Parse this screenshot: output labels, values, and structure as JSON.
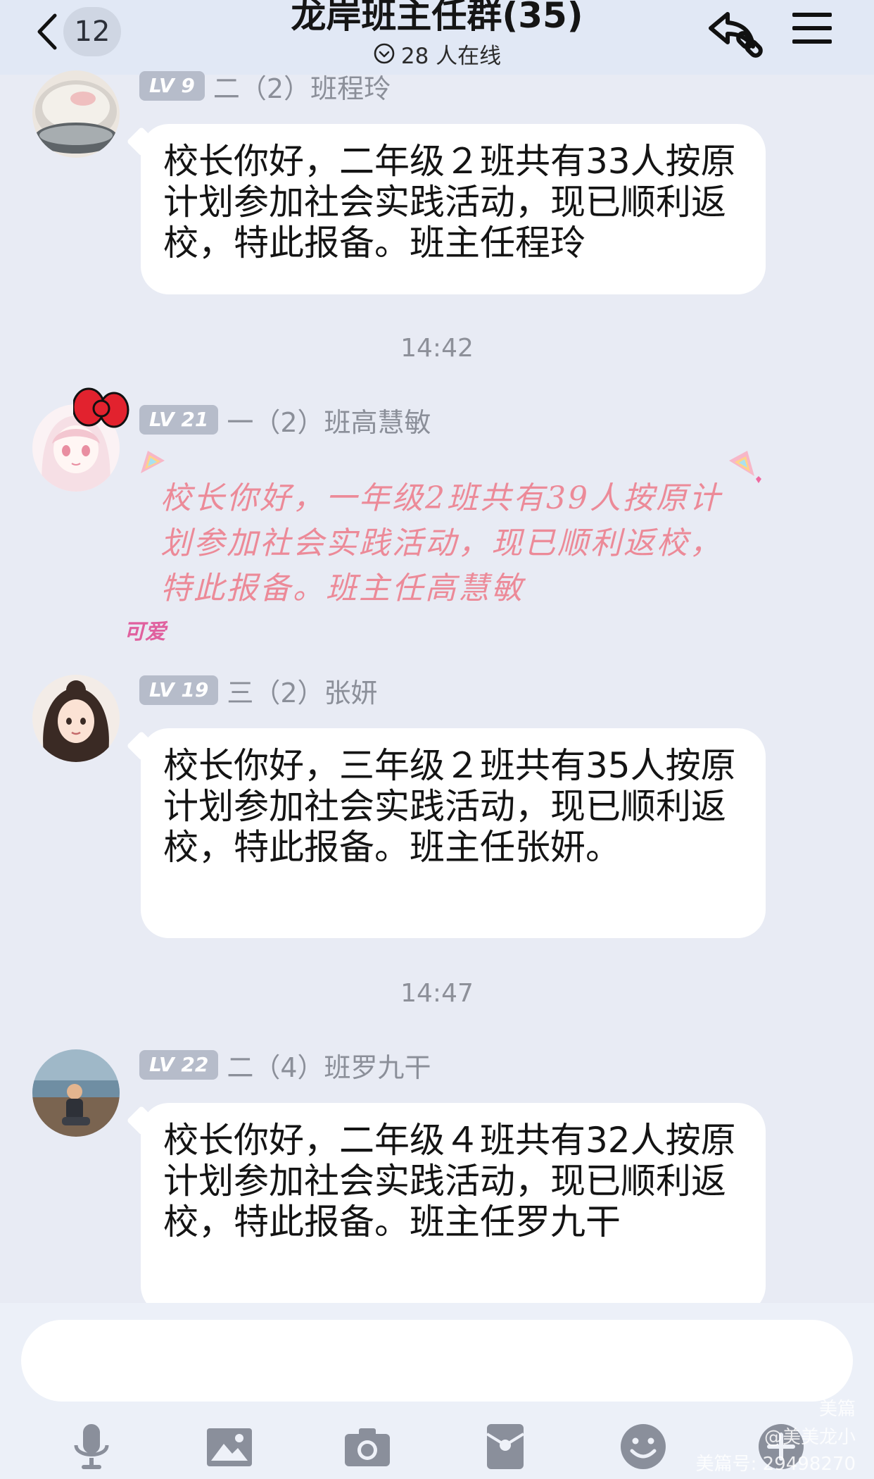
{
  "header": {
    "back_count": "12",
    "title": "龙岸班主任群(35)",
    "online": "28 人在线"
  },
  "messages": [
    {
      "level": "LV 9",
      "sender": "二（2）班程玲",
      "text": "校长你好，二年级２班共有33人按原计划参加社会实践活动，现已顺利返校，特此报备。班主任程玲"
    },
    {
      "level": "LV 21",
      "sender": "一（2）班高慧敏",
      "text": "校长你好，一年级2班共有39人按原计划参加社会实践活动，现已顺利返校，特此报备。班主任高慧敏",
      "sticker": "可爱"
    },
    {
      "level": "LV 19",
      "sender": "三（2）张妍",
      "text": "校长你好，三年级２班共有35人按原计划参加社会实践活动，现已顺利返校，特此报备。班主任张妍。"
    },
    {
      "level": "LV 22",
      "sender": "二（4）班罗九干",
      "text": "校长你好，二年级４班共有32人按原计划参加社会实践活动，现已顺利返校，特此报备。班主任罗九干"
    }
  ],
  "timestamps": [
    "14:42",
    "14:47"
  ],
  "composer": {
    "placeholder": ""
  },
  "toolbar": [
    "microphone-icon",
    "image-icon",
    "camera-icon",
    "red-packet-icon",
    "emoji-icon",
    "plus-icon"
  ],
  "watermark": {
    "brand": "美篇",
    "author": "@美美龙小",
    "id": "美篇号: 29498270"
  }
}
